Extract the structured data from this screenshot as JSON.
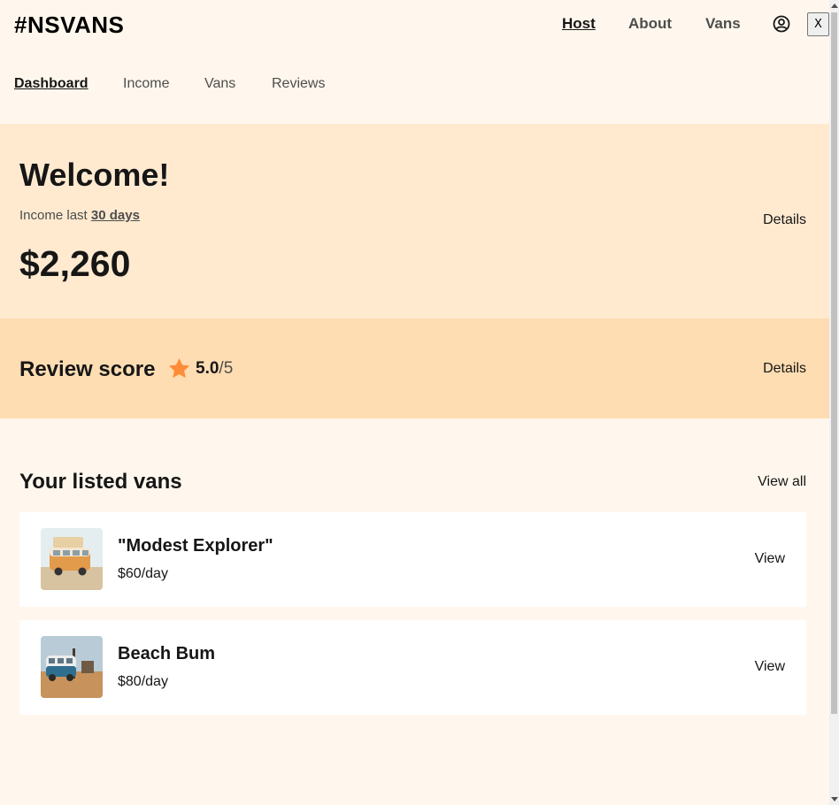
{
  "header": {
    "logo": "#NSVANS",
    "nav": [
      {
        "label": "Host",
        "active": true
      },
      {
        "label": "About",
        "active": false
      },
      {
        "label": "Vans",
        "active": false
      }
    ],
    "user_icon": "user-circle-icon",
    "close_label": "X"
  },
  "host_nav": {
    "items": [
      {
        "label": "Dashboard",
        "active": true
      },
      {
        "label": "Income",
        "active": false
      },
      {
        "label": "Vans",
        "active": false
      },
      {
        "label": "Reviews",
        "active": false
      }
    ]
  },
  "income": {
    "title": "Welcome!",
    "prefix": "Income last ",
    "period": "30 days",
    "amount": "$2,260",
    "details_label": "Details"
  },
  "review": {
    "title": "Review score",
    "star_icon": "star-icon",
    "score": "5.0",
    "out_of": "/5",
    "details_label": "Details"
  },
  "vans": {
    "title": "Your listed vans",
    "view_all_label": "View all",
    "items": [
      {
        "name": "\"Modest Explorer\"",
        "price": "$60/day",
        "view_label": "View"
      },
      {
        "name": "Beach Bum",
        "price": "$80/day",
        "view_label": "View"
      }
    ]
  },
  "colors": {
    "background": "#FFF7ED",
    "income_bg": "#FFEAD0",
    "review_bg": "#FFDDB2",
    "star": "#FF8C38",
    "card_bg": "#FFFFFF"
  }
}
